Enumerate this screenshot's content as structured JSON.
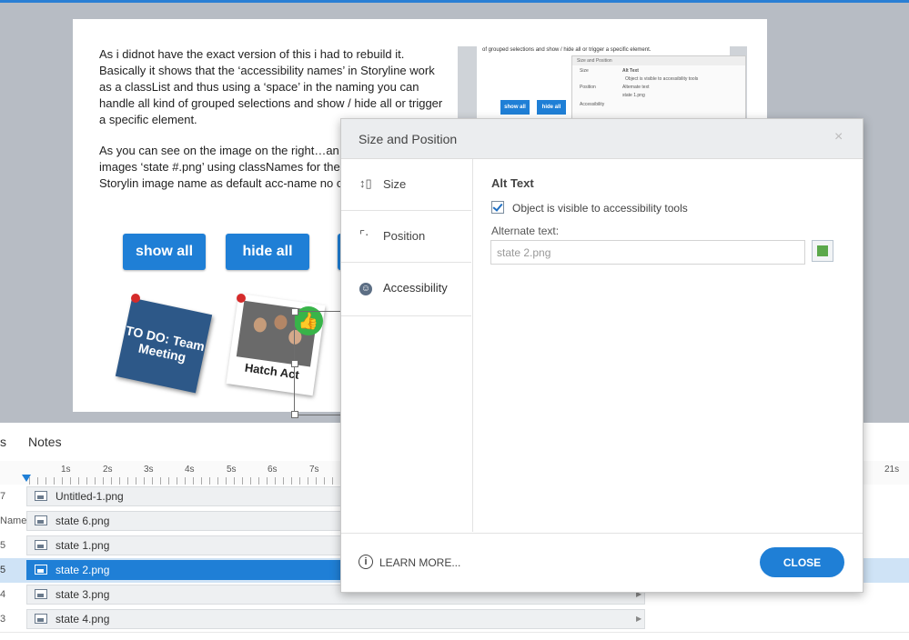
{
  "slide": {
    "paragraph1": "As i didnot have the exact version of this i had to rebuild it. Basically it shows that the ‘accessibility names’ in Storyline work as a classList and thus using a ‘space’ in the naming you can handle all kind of grouped selections and show / hide all or trigger a specific element.",
    "paragraph2": "As you can see on the image on the right…an itself. i named the images ‘state #.png’ using classNames for these 6 elements. As Storylin image name as default acc-name no changes",
    "show_all": "show all",
    "hide_all": "hide all",
    "todo_card": "TO DO: Team Meeting",
    "photo_caption": "Hatch Act",
    "mini": {
      "text": "of grouped selections and show / hide all or trigger a specific element.",
      "show_all": "show all",
      "hide_all": "hide all",
      "dialog_title": "Size and Position",
      "alt_text": "Alt Text",
      "size": "Size",
      "position": "Position",
      "accessibility": "Accessibility",
      "checkbox": "Object is visible to accessibility tools",
      "alternate": "Alternate text",
      "value": "state 1.png"
    }
  },
  "timeline": {
    "tabs": [
      "s",
      "Notes"
    ],
    "ruler": [
      "1s",
      "2s",
      "3s",
      "4s",
      "5s",
      "6s",
      "7s"
    ],
    "ruler_end": "21s",
    "rows": [
      {
        "num": "7",
        "name": "Untitled-1.png"
      },
      {
        "num": "Name",
        "name": "state 6.png"
      },
      {
        "num": "5",
        "name": "state 1.png"
      },
      {
        "num": "5",
        "name": "state 2.png"
      },
      {
        "num": "4",
        "name": "state 3.png"
      },
      {
        "num": "3",
        "name": "state 4.png"
      }
    ]
  },
  "dialog": {
    "title": "Size and Position",
    "close_x": "×",
    "nav": {
      "size": "Size",
      "position": "Position",
      "accessibility": "Accessibility"
    },
    "section_title": "Alt Text",
    "checkbox_label": "Object is visible to accessibility tools",
    "checkbox_checked": true,
    "alt_label": "Alternate text:",
    "alt_value": "state 2.png",
    "learn_more": "LEARN MORE...",
    "close": "CLOSE"
  },
  "colors": {
    "accent": "#1f7fd6",
    "todo_card": "#2d5888",
    "thumb_badge": "#38b449"
  }
}
